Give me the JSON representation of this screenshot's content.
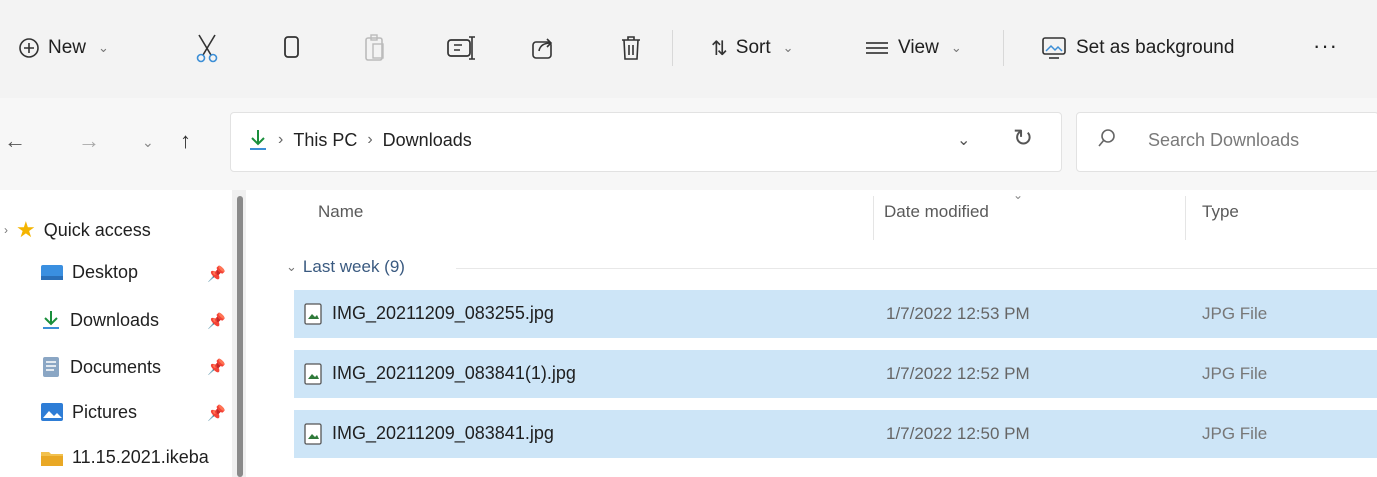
{
  "toolbar": {
    "new_label": "New",
    "sort_label": "Sort",
    "view_label": "View",
    "set_background_label": "Set as background",
    "more_label": "···"
  },
  "address": {
    "crumbs": [
      "This PC",
      "Downloads"
    ],
    "search_placeholder": "Search Downloads"
  },
  "sidebar": {
    "items": [
      {
        "label": "Quick access",
        "icon": "star-icon"
      },
      {
        "label": "Desktop",
        "icon": "desktop-icon"
      },
      {
        "label": "Downloads",
        "icon": "download-icon"
      },
      {
        "label": "Documents",
        "icon": "documents-icon"
      },
      {
        "label": "Pictures",
        "icon": "pictures-icon"
      },
      {
        "label": "11.15.2021.ikeba",
        "icon": "folder-icon"
      }
    ]
  },
  "columns": {
    "name": "Name",
    "date": "Date modified",
    "type": "Type"
  },
  "group": {
    "label": "Last week (9)"
  },
  "files": [
    {
      "name": "IMG_20211209_083255.jpg",
      "date": "1/7/2022 12:53 PM",
      "type": "JPG File"
    },
    {
      "name": "IMG_20211209_083841(1).jpg",
      "date": "1/7/2022 12:52 PM",
      "type": "JPG File"
    },
    {
      "name": "IMG_20211209_083841.jpg",
      "date": "1/7/2022 12:50 PM",
      "type": "JPG File"
    }
  ],
  "colors": {
    "selection": "#cde5f7",
    "accent": "#1a8f3c",
    "star": "#f4b400"
  }
}
